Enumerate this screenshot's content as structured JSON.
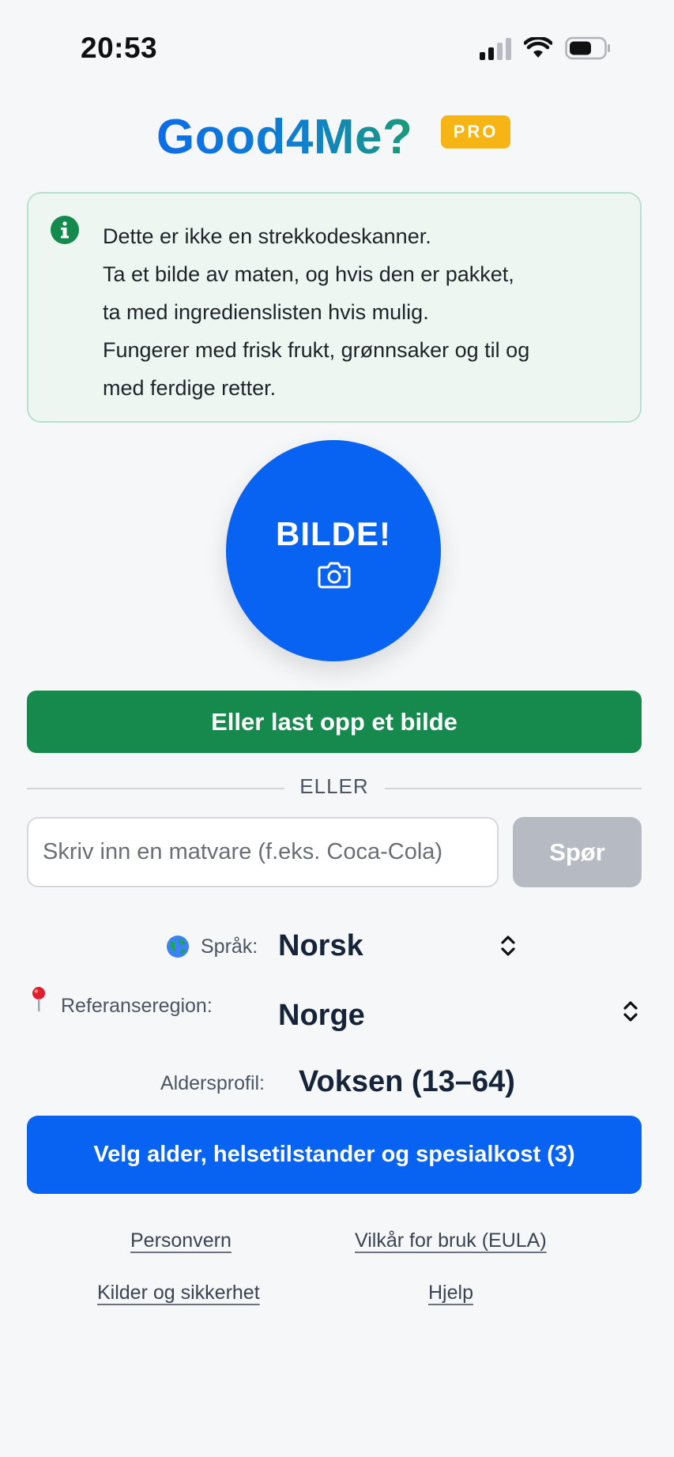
{
  "status_bar": {
    "time": "20:53"
  },
  "header": {
    "title": "Good4Me?",
    "badge": "PRO"
  },
  "info": {
    "lines": [
      "Dette er ikke en strekkodeskanner.",
      "Ta et bilde av maten, og hvis den er pakket,",
      "ta med ingredienslisten hvis mulig.",
      "Fungerer med frisk frukt, grønnsaker og til og",
      "med ferdige retter."
    ]
  },
  "camera": {
    "label": "BILDE!"
  },
  "upload": {
    "label": "Eller last opp et bilde"
  },
  "divider": {
    "label": "ELLER"
  },
  "search": {
    "placeholder": "Skriv inn en matvare (f.eks. Coca-Cola)",
    "value": "",
    "button": "Spør"
  },
  "settings": {
    "language": {
      "label": "Språk:",
      "value": "Norsk"
    },
    "region": {
      "label": "Referanseregion:",
      "value": "Norge"
    },
    "age": {
      "label": "Aldersprofil:",
      "value": "Voksen (13–64)"
    }
  },
  "profile_button": {
    "label": "Velg alder, helsetilstander og spesialkost (3)"
  },
  "footer": {
    "privacy": "Personvern",
    "terms": "Vilkår for bruk (EULA)",
    "sources": "Kilder og sikkerhet",
    "help": "Hjelp"
  },
  "colors": {
    "primary": "#0862f2",
    "success": "#168a4c",
    "badge": "#f7b515",
    "disabled": "#b6bac2",
    "info_bg": "#eef6f2"
  },
  "icons": {
    "info": "info-icon",
    "camera": "camera-icon",
    "language": "globe-icon",
    "region": "pin-icon"
  }
}
